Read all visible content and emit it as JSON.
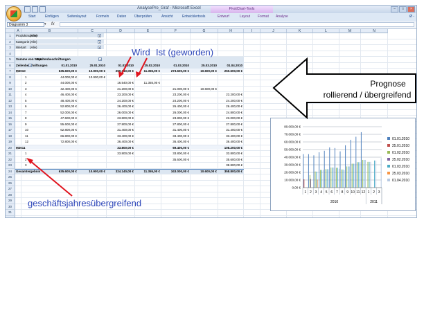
{
  "window": {
    "title": "AnalysePro_Graf - Microsoft Excel",
    "context_group": "PivotChart-Tools",
    "min": "–",
    "max": "□",
    "close": "×"
  },
  "ribbon": {
    "tabs": [
      "Start",
      "Einfügen",
      "Seitenlayout",
      "Formeln",
      "Daten",
      "Überprüfen",
      "Ansicht",
      "Entwicklertools",
      "Entwurf",
      "Layout",
      "Format",
      "Analyse"
    ],
    "right": "Ø -"
  },
  "formula_bar": {
    "name_box": "Diagramm 3",
    "fx": "fx",
    "value": ""
  },
  "columns": [
    "A",
    "B",
    "C",
    "D",
    "E",
    "F",
    "G",
    "H",
    "I",
    "J",
    "K",
    "L",
    "M",
    "N"
  ],
  "rows": [
    "1",
    "2",
    "3",
    "4",
    "5",
    "6",
    "7",
    "8",
    "9",
    "10",
    "11",
    "12",
    "13",
    "14",
    "15",
    "16",
    "17",
    "18",
    "19",
    "20",
    "21",
    "22",
    "23",
    "24",
    "25",
    "26",
    "27",
    "28",
    "29",
    "30",
    "31",
    "32"
  ],
  "filters": [
    {
      "label": "Produktnummer",
      "value": "(Alle)"
    },
    {
      "label": "Kategorie",
      "value": "(Alle)"
    },
    {
      "label": "Wertart",
      "value": "(Alle)"
    }
  ],
  "pivot": {
    "value_label": "Summe von Wert",
    "col_label": "Spaltenbeschriftungen",
    "row_label": "Zeilenbeschriftungen",
    "col_headers": [
      "01.01.2010",
      "25.01.2010",
      "01.02.2010",
      "25.02.2010",
      "01.03.2010",
      "25.03.2010",
      "01.04.2010"
    ],
    "rows": [
      {
        "r": "7",
        "label": "⊟2010",
        "bold": true,
        "values": [
          "635.600,00 €",
          "10.900,00 €",
          "290.340,00 €",
          "11.355,00 €",
          "273.600,00 €",
          "10.600,00 €",
          "250.600,00 €"
        ]
      },
      {
        "r": "8",
        "label": "1",
        "values": [
          "44.000,00 €",
          "10.900,00 €",
          "",
          "",
          "",
          "",
          ""
        ]
      },
      {
        "r": "9",
        "label": "2",
        "values": [
          "44.000,00 €",
          "",
          "16.540,00 €",
          "11.355,00 €",
          "",
          "",
          ""
        ]
      },
      {
        "r": "10",
        "label": "3",
        "values": [
          "42.400,00 €",
          "",
          "21.200,00 €",
          "",
          "21.000,00 €",
          "10.600,00 €",
          ""
        ]
      },
      {
        "r": "11",
        "label": "4",
        "values": [
          "46.400,00 €",
          "",
          "23.200,00 €",
          "",
          "23.200,00 €",
          "",
          "23.200,00 €"
        ]
      },
      {
        "r": "12",
        "label": "5",
        "values": [
          "48.400,00 €",
          "",
          "24.200,00 €",
          "",
          "24.200,00 €",
          "",
          "24.200,00 €"
        ]
      },
      {
        "r": "13",
        "label": "6",
        "values": [
          "52.800,00 €",
          "",
          "26.400,00 €",
          "",
          "26.400,00 €",
          "",
          "26.400,00 €"
        ]
      },
      {
        "r": "14",
        "label": "7",
        "values": [
          "52.000,00 €",
          "",
          "26.000,00 €",
          "",
          "26.000,00 €",
          "",
          "24.800,00 €"
        ]
      },
      {
        "r": "15",
        "label": "8",
        "values": [
          "47.600,00 €",
          "",
          "23.800,00 €",
          "",
          "23.800,00 €",
          "",
          "23.000,00 €"
        ]
      },
      {
        "r": "16",
        "label": "9",
        "values": [
          "55.600,00 €",
          "",
          "27.800,00 €",
          "",
          "27.800,00 €",
          "",
          "27.800,00 €"
        ]
      },
      {
        "r": "17",
        "label": "10",
        "values": [
          "62.800,00 €",
          "",
          "31.400,00 €",
          "",
          "31.400,00 €",
          "",
          "31.400,00 €"
        ]
      },
      {
        "r": "18",
        "label": "11",
        "values": [
          "66.800,00 €",
          "",
          "33.400,00 €",
          "",
          "33.400,00 €",
          "",
          "33.400,00 €"
        ]
      },
      {
        "r": "19",
        "label": "12",
        "values": [
          "72.800,00 €",
          "",
          "36.400,00 €",
          "",
          "36.400,00 €",
          "",
          "36.400,00 €"
        ]
      },
      {
        "r": "20",
        "label": "⊟2011",
        "bold": true,
        "values": [
          "",
          "",
          "33.800,00 €",
          "",
          "69.400,00 €",
          "",
          "108.200,00 €"
        ]
      },
      {
        "r": "21",
        "label": "1",
        "values": [
          "",
          "",
          "33.800,00 €",
          "",
          "33.800,00 €",
          "",
          "33.800,00 €"
        ]
      },
      {
        "r": "22",
        "label": "2",
        "values": [
          "",
          "",
          "",
          "",
          "35.600,00 €",
          "",
          "35.600,00 €"
        ]
      },
      {
        "r": "23",
        "label": "3",
        "values": [
          "",
          "",
          "",
          "",
          "",
          "",
          "38.800,00 €"
        ]
      },
      {
        "r": "24",
        "label": "Gesamtergebnis",
        "bold": true,
        "values": [
          "635.600,00 €",
          "10.900,00 €",
          "324.140,00 €",
          "11.355,00 €",
          "343.000,00 €",
          "10.600,00 €",
          "358.800,00 €"
        ]
      }
    ]
  },
  "annotations": {
    "wird": "Wird",
    "ist": "Ist (geworden)",
    "prognose_1": "Prognose",
    "prognose_2": "rollierend / übergreifend",
    "gj": "geschäftsjahresübergreifend"
  },
  "colors": {
    "arrow_red": "#e0141e",
    "annot_blue": "#2d46b9"
  },
  "chart_data": {
    "type": "bar",
    "categories": [
      "1",
      "2",
      "3",
      "4",
      "5",
      "6",
      "7",
      "8",
      "9",
      "10",
      "11",
      "12",
      "1",
      "2",
      "3"
    ],
    "groups": [
      {
        "name": "2010",
        "count": 12
      },
      {
        "name": "2011",
        "count": 3
      }
    ],
    "ylim": [
      0,
      80000
    ],
    "yticks": [
      "0,00 €",
      "10.000,00 €",
      "20.000,00 €",
      "30.000,00 €",
      "40.000,00 €",
      "50.000,00 €",
      "60.000,00 €",
      "70.000,00 €",
      "80.000,00 €"
    ],
    "series": [
      {
        "name": "01.01.2010",
        "color": "#4f81bd",
        "values": [
          44000,
          44000,
          42400,
          46400,
          48400,
          52800,
          52000,
          47600,
          55600,
          62800,
          66800,
          72800,
          0,
          0,
          0
        ]
      },
      {
        "name": "25.01.2010",
        "color": "#c0504d",
        "values": [
          10900,
          0,
          0,
          0,
          0,
          0,
          0,
          0,
          0,
          0,
          0,
          0,
          0,
          0,
          0
        ]
      },
      {
        "name": "01.02.2010",
        "color": "#9bbb59",
        "values": [
          0,
          16540,
          21200,
          23200,
          24200,
          26400,
          26000,
          23800,
          27800,
          31400,
          33400,
          36400,
          33800,
          0,
          0
        ]
      },
      {
        "name": "25.02.2010",
        "color": "#8064a2",
        "values": [
          0,
          11355,
          0,
          0,
          0,
          0,
          0,
          0,
          0,
          0,
          0,
          0,
          0,
          0,
          0
        ]
      },
      {
        "name": "01.03.2010",
        "color": "#4bacc6",
        "values": [
          0,
          0,
          21000,
          23200,
          24200,
          26400,
          26000,
          23800,
          27800,
          31400,
          33400,
          36400,
          33800,
          35600,
          0
        ]
      },
      {
        "name": "25.03.2010",
        "color": "#f79646",
        "values": [
          0,
          0,
          10600,
          0,
          0,
          0,
          0,
          0,
          0,
          0,
          0,
          0,
          0,
          0,
          0
        ]
      },
      {
        "name": "01.04.2010",
        "color": "#b7c9e2",
        "values": [
          0,
          0,
          0,
          23200,
          24200,
          26400,
          24800,
          23000,
          27800,
          31400,
          33400,
          36400,
          33800,
          35600,
          38800
        ]
      }
    ]
  }
}
